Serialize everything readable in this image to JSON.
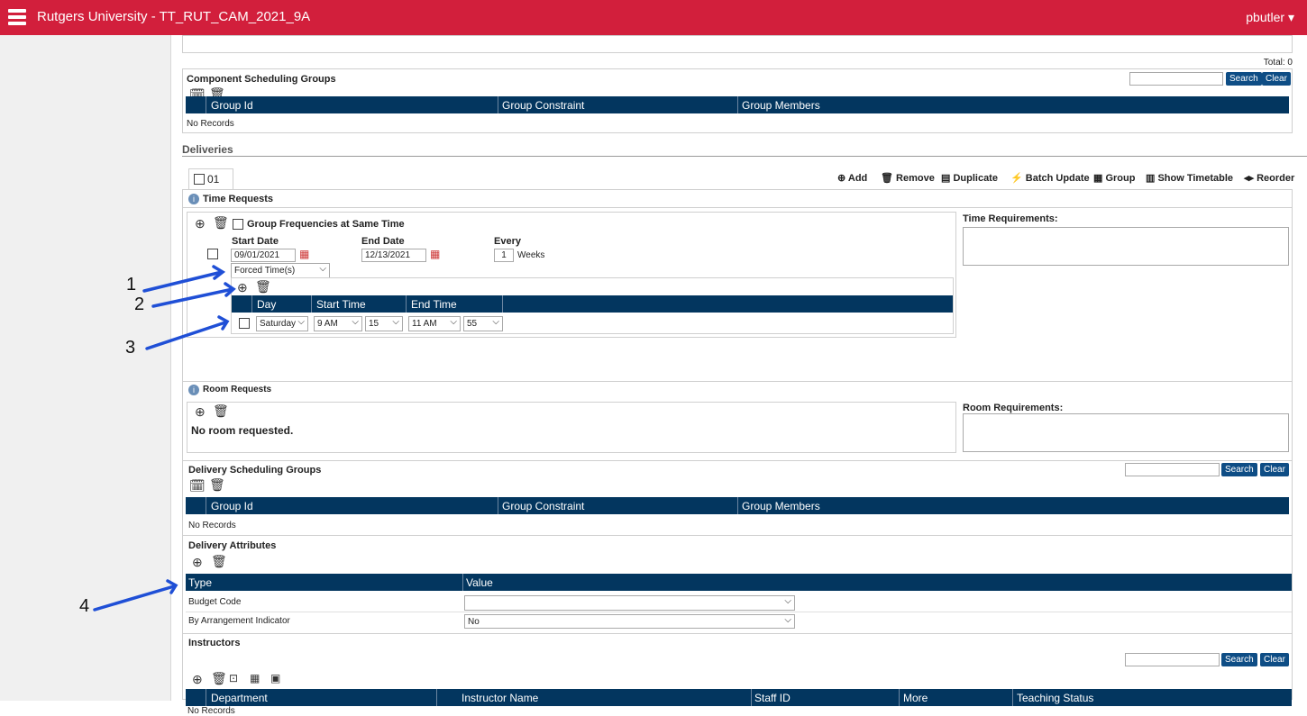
{
  "header": {
    "title": "Rutgers University - TT_RUT_CAM_2021_9A",
    "user": "pbutler"
  },
  "total_text": "Total: 0",
  "search_label": "Search",
  "clear_label": "Clear",
  "component_groups": {
    "title": "Component Scheduling Groups",
    "cols": [
      "Group Id",
      "Group Constraint",
      "Group Members"
    ],
    "empty": "No Records"
  },
  "deliveries": {
    "title": "Deliveries",
    "tab": "01",
    "actions": [
      "Add",
      "Remove",
      "Duplicate",
      "Batch Update",
      "Group",
      "Show Timetable",
      "Reorder"
    ]
  },
  "time_requests": {
    "title": "Time Requests",
    "group_freq": "Group Frequencies at Same Time",
    "start_label": "Start Date",
    "start_val": "09/01/2021",
    "end_label": "End Date",
    "end_val": "12/13/2021",
    "every_label": "Every",
    "every_val": "1",
    "weeks": "Weeks",
    "type_val": "Forced Time(s)",
    "cols": [
      "Day",
      "Start Time",
      "End Time"
    ],
    "row": {
      "day": "Saturday",
      "start_h": "9 AM",
      "start_m": "15",
      "end_h": "11 AM",
      "end_m": "55"
    },
    "req_label": "Time Requirements:"
  },
  "room_requests": {
    "title": "Room Requests",
    "empty": "No room requested.",
    "req_label": "Room Requirements:"
  },
  "delivery_groups": {
    "title": "Delivery Scheduling Groups",
    "cols": [
      "Group Id",
      "Group Constraint",
      "Group Members"
    ],
    "empty": "No Records"
  },
  "attributes": {
    "title": "Delivery Attributes",
    "cols": [
      "Type",
      "Value"
    ],
    "rows": [
      {
        "type": "Budget Code",
        "value": ""
      },
      {
        "type": "By Arrangement Indicator",
        "value": "No"
      }
    ]
  },
  "instructors": {
    "title": "Instructors",
    "cols": [
      "Department",
      "Instructor Name",
      "Staff ID",
      "More",
      "Teaching Status"
    ],
    "empty": "No Records"
  },
  "annotations": [
    "1",
    "2",
    "3",
    "4"
  ],
  "colors": {
    "brand": "#d21f3c",
    "header": "#03365f",
    "button": "#0e4d85",
    "arrow": "#1f4fd6"
  }
}
